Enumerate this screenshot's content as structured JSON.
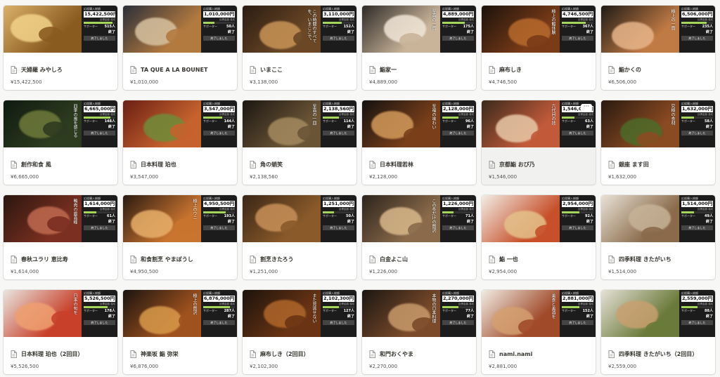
{
  "cards": [
    {
      "title": "天婦羅 みやしろ",
      "price": "¥15,422,500",
      "cover": {
        "amount": "15,422,500円",
        "people": "515人",
        "vertical": "",
        "c1": "#d9b06a",
        "c2": "#8a5b1f",
        "c3": "#f3d38a",
        "fill": 0.9
      }
    },
    {
      "title": "TA QUE A LA BOUNET",
      "price": "¥1,010,000",
      "cover": {
        "amount": "1,010,000円",
        "people": "50人",
        "vertical": "",
        "c1": "#2b2f3a",
        "c2": "#b37a3f",
        "c3": "#d7c2a0",
        "fill": 0.35
      }
    },
    {
      "title": "いまここ",
      "price": "¥3,138,000",
      "cover": {
        "amount": "3,110,000円",
        "people": "152人",
        "vertical": "この時間のすべてを、いまここで。",
        "c1": "#2a1c12",
        "c2": "#6b4726",
        "c3": "#c99557",
        "fill": 0.6
      }
    },
    {
      "title": "鮨家一",
      "price": "¥4,889,000",
      "cover": {
        "amount": "4,889,000円",
        "people": "175人",
        "vertical": "至高の一貫",
        "c1": "#2e2a26",
        "c2": "#c9b49a",
        "c3": "#f1e6d8",
        "fill": 0.7
      }
    },
    {
      "title": "麻布しき",
      "price": "¥4,746,500",
      "cover": {
        "amount": "4,746,500円",
        "people": "367人",
        "vertical": "極上の鰻体験",
        "c1": "#1b120c",
        "c2": "#7a3b17",
        "c3": "#b86a2c",
        "fill": 0.75
      }
    },
    {
      "title": "鮨かくの",
      "price": "¥6,506,000",
      "cover": {
        "amount": "6,506,000円",
        "people": "235人",
        "vertical": "極上の一貫",
        "c1": "#1e1a16",
        "c2": "#c07a44",
        "c3": "#e8b58a",
        "fill": 0.8
      }
    },
    {
      "title": "創作和食 風",
      "price": "¥6,665,000",
      "cover": {
        "amount": "6,665,000円",
        "people": "148人",
        "vertical": "四季の風を感じる",
        "c1": "#0f1a10",
        "c2": "#2d3b1f",
        "c3": "#6e7a3a",
        "fill": 0.85
      }
    },
    {
      "title": "日本料理 珀也",
      "price": "¥3,547,000",
      "cover": {
        "amount": "3,547,000円",
        "people": "144人",
        "vertical": "",
        "c1": "#6b1f14",
        "c2": "#c5622e",
        "c3": "#6f8c3a",
        "fill": 0.6
      }
    },
    {
      "title": "角の蛸笑",
      "price": "¥2,138,560",
      "cover": {
        "amount": "2,138,560円",
        "people": "114人",
        "vertical": "至高の一皿",
        "c1": "#1b1611",
        "c2": "#6a5436",
        "c3": "#a48a60",
        "fill": 0.5
      }
    },
    {
      "title": "日本料理若林",
      "price": "¥2,128,000",
      "cover": {
        "amount": "2,128,000円",
        "people": "96人",
        "vertical": "至福の味わい",
        "c1": "#141210",
        "c2": "#7a3f1a",
        "c3": "#d39a5a",
        "fill": 0.5
      }
    },
    {
      "title": "京都鮨 おび乃",
      "price": "¥1,546,000",
      "cover": {
        "amount": "1,546,000円",
        "people": "63人",
        "vertical": "六代目の技",
        "c1": "#3a2a1c",
        "c2": "#c25a3a",
        "c3": "#e8c9a8",
        "fill": 0.4
      }
    },
    {
      "title": "銀座 ます田",
      "price": "¥1,632,000",
      "cover": {
        "amount": "1,632,000円",
        "people": "58人",
        "vertical": "究極の食材",
        "c1": "#2a1a10",
        "c2": "#8a4a22",
        "c3": "#4d6b2a",
        "fill": 0.4
      }
    },
    {
      "title": "春秋ユラリ 恵比寿",
      "price": "¥1,614,000",
      "cover": {
        "amount": "1,614,000円",
        "people": "61人",
        "vertical": "鴨肉の最高峰",
        "c1": "#2a1610",
        "c2": "#7a2f20",
        "c3": "#c06a50",
        "fill": 0.4
      }
    },
    {
      "title": "和食割烹 やまぼうし",
      "price": "¥4,950,500",
      "cover": {
        "amount": "4,950,500円",
        "people": "193人",
        "vertical": "極上のウニ",
        "c1": "#2a1a12",
        "c2": "#c9742f",
        "c3": "#e9b06a",
        "fill": 0.7
      }
    },
    {
      "title": "割烹きたろう",
      "price": "¥1,251,000",
      "cover": {
        "amount": "1,251,000円",
        "people": "50人",
        "vertical": "",
        "c1": "#3a2616",
        "c2": "#8a5a2a",
        "c3": "#c89058",
        "fill": 0.35
      }
    },
    {
      "title": "白金よこ山",
      "price": "¥1,226,000",
      "cover": {
        "amount": "1,226,000円",
        "people": "71人",
        "vertical": "この冬だけの贅沢",
        "c1": "#2c241c",
        "c2": "#8a6a4a",
        "c3": "#d9b88a",
        "fill": 0.35
      }
    },
    {
      "title": "鮨 一也",
      "price": "¥2,954,000",
      "cover": {
        "amount": "2,954,000円",
        "people": "92人",
        "vertical": "",
        "c1": "#f2ede6",
        "c2": "#c7502a",
        "c3": "#e5c28a",
        "fill": 0.55
      }
    },
    {
      "title": "四季料理 きたがいち",
      "price": "¥1,514,000",
      "cover": {
        "amount": "1,514,000円",
        "people": "49人",
        "vertical": "",
        "c1": "#e9e2d6",
        "c2": "#8a6a4a",
        "c3": "#c7b398",
        "fill": 0.4
      }
    },
    {
      "title": "日本料理 珀也（2回目）",
      "price": "¥5,526,500",
      "cover": {
        "amount": "5,526,500円",
        "people": "178人",
        "vertical": "日本の旬を",
        "c1": "#e9e5df",
        "c2": "#c8402a",
        "c3": "#f0a070",
        "fill": 0.75
      }
    },
    {
      "title": "神楽坂 鮨 弥栄",
      "price": "¥6,876,000",
      "cover": {
        "amount": "6,876,000円",
        "people": "287人",
        "vertical": "極上の贅沢",
        "c1": "#1a1410",
        "c2": "#a0521e",
        "c3": "#d89a4a",
        "fill": 0.85
      }
    },
    {
      "title": "麻布しき（2回目）",
      "price": "¥2,102,300",
      "cover": {
        "amount": "2,102,300円",
        "people": "127人",
        "vertical": "また見逃せない",
        "c1": "#1c130c",
        "c2": "#6a3414",
        "c3": "#b0662a",
        "fill": 0.5
      }
    },
    {
      "title": "和門おくやま",
      "price": "¥2,270,000",
      "cover": {
        "amount": "2,270,000円",
        "people": "77人",
        "vertical": "本物の日本料理",
        "c1": "#1a1612",
        "c2": "#7a4a2a",
        "c3": "#c89a6a",
        "fill": 0.5
      }
    },
    {
      "title": "nami.nami",
      "price": "¥2,881,000",
      "cover": {
        "amount": "2,881,000円",
        "people": "152人",
        "vertical": "美食と美酒を",
        "c1": "#f1ece4",
        "c2": "#a04a2a",
        "c3": "#d4a070",
        "fill": 0.55
      }
    },
    {
      "title": "四季料理 きたがいち（2回目）",
      "price": "¥2,559,000",
      "cover": {
        "amount": "2,559,000円",
        "people": "88人",
        "vertical": "",
        "c1": "#e6e1d6",
        "c2": "#6a7a3a",
        "c3": "#c9a070",
        "fill": 0.5
      }
    }
  ],
  "panel": {
    "header": "応援購入総額",
    "sub": "目標金額 達成",
    "supporters": "サポーター",
    "end_label": "終了",
    "button": "終了しました"
  },
  "icons": {
    "doc": "page-icon",
    "more": "more-icon"
  },
  "more_label": "···"
}
